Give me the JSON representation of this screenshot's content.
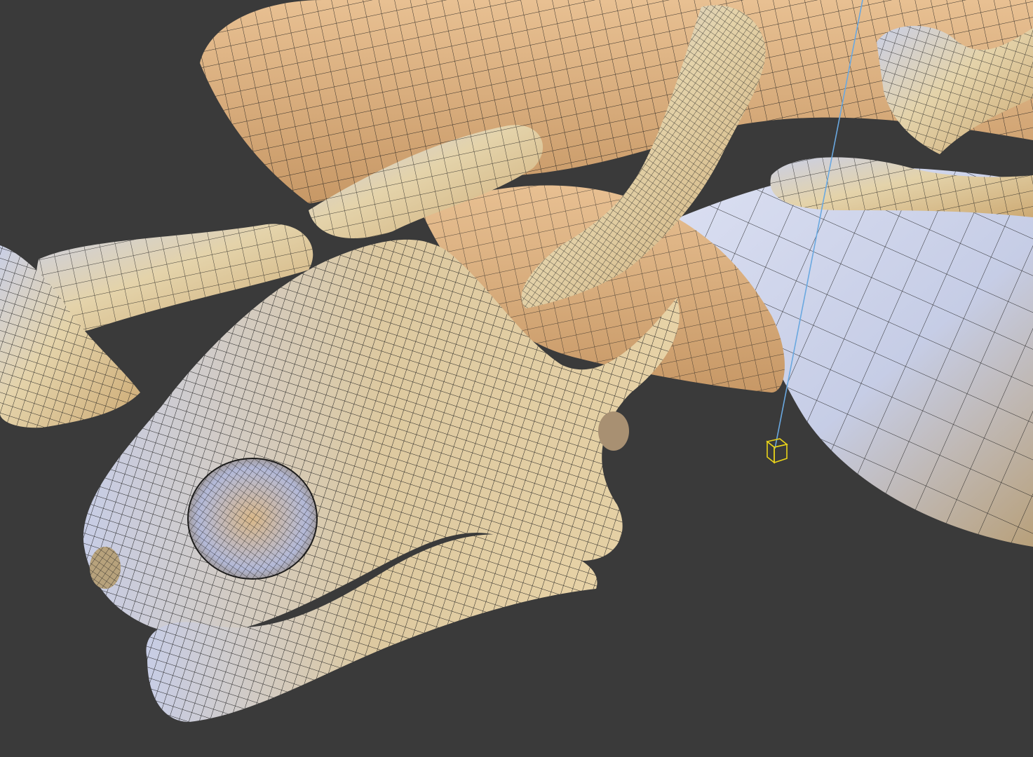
{
  "viewport": {
    "background": "#3a3a3a",
    "mesh_fill_light": "#dcc9a4",
    "mesh_fill_warm": "#e9b98a",
    "mesh_fill_cool": "#c9cfe6",
    "wire_color": "#1b1b1b",
    "guide_line_color": "#6aa8e0",
    "helper_color": "#e8d21a",
    "helper_icon": "cube-helper-icon"
  }
}
